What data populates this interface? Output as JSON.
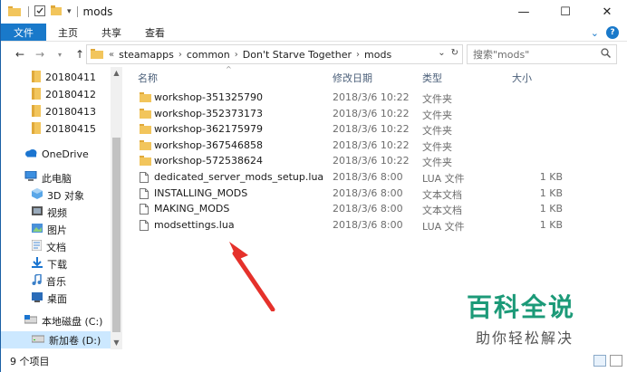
{
  "window": {
    "title": "mods",
    "controls": {
      "minimize": "—",
      "maximize": "☐",
      "close": "✕"
    }
  },
  "ribbon": {
    "tabs": [
      "文件",
      "主页",
      "共享",
      "查看"
    ]
  },
  "address": {
    "crumbs": [
      "steamapps",
      "common",
      "Don't Starve Together",
      "mods"
    ]
  },
  "search": {
    "placeholder": "搜索\"mods\""
  },
  "nav_pane": {
    "items": [
      {
        "label": "20180411",
        "icon": "folder-icon"
      },
      {
        "label": "20180412",
        "icon": "folder-icon"
      },
      {
        "label": "20180413",
        "icon": "folder-icon"
      },
      {
        "label": "20180415",
        "icon": "folder-icon"
      },
      {
        "label": "OneDrive",
        "icon": "cloud-icon"
      },
      {
        "label": "此电脑",
        "icon": "computer-icon"
      },
      {
        "label": "3D 对象",
        "icon": "3d-objects-icon"
      },
      {
        "label": "视频",
        "icon": "video-icon"
      },
      {
        "label": "图片",
        "icon": "pictures-icon"
      },
      {
        "label": "文档",
        "icon": "documents-icon"
      },
      {
        "label": "下载",
        "icon": "download-icon"
      },
      {
        "label": "音乐",
        "icon": "music-icon"
      },
      {
        "label": "桌面",
        "icon": "desktop-icon"
      },
      {
        "label": "本地磁盘 (C:)",
        "icon": "drive-icon"
      },
      {
        "label": "新加卷 (D:)",
        "icon": "drive-icon"
      }
    ]
  },
  "columns": {
    "name": "名称",
    "date": "修改日期",
    "type": "类型",
    "size": "大小"
  },
  "files": [
    {
      "name": "workshop-351325790",
      "date": "2018/3/6 10:22",
      "type": "文件夹",
      "size": "",
      "kind": "folder"
    },
    {
      "name": "workshop-352373173",
      "date": "2018/3/6 10:22",
      "type": "文件夹",
      "size": "",
      "kind": "folder"
    },
    {
      "name": "workshop-362175979",
      "date": "2018/3/6 10:22",
      "type": "文件夹",
      "size": "",
      "kind": "folder"
    },
    {
      "name": "workshop-367546858",
      "date": "2018/3/6 10:22",
      "type": "文件夹",
      "size": "",
      "kind": "folder"
    },
    {
      "name": "workshop-572538624",
      "date": "2018/3/6 10:22",
      "type": "文件夹",
      "size": "",
      "kind": "folder"
    },
    {
      "name": "dedicated_server_mods_setup.lua",
      "date": "2018/3/6 8:00",
      "type": "LUA 文件",
      "size": "1 KB",
      "kind": "file"
    },
    {
      "name": "INSTALLING_MODS",
      "date": "2018/3/6 8:00",
      "type": "文本文档",
      "size": "1 KB",
      "kind": "file"
    },
    {
      "name": "MAKING_MODS",
      "date": "2018/3/6 8:00",
      "type": "文本文档",
      "size": "1 KB",
      "kind": "file"
    },
    {
      "name": "modsettings.lua",
      "date": "2018/3/6 8:00",
      "type": "LUA 文件",
      "size": "1 KB",
      "kind": "file"
    }
  ],
  "status": {
    "count": "9 个项目"
  },
  "watermark": {
    "title": "百科全说",
    "subtitle": "助你轻松解决"
  },
  "colors": {
    "accent": "#1979ca",
    "folder": "#f2c55c",
    "arrow": "#e5312b",
    "watermark": "#1c9a78"
  }
}
